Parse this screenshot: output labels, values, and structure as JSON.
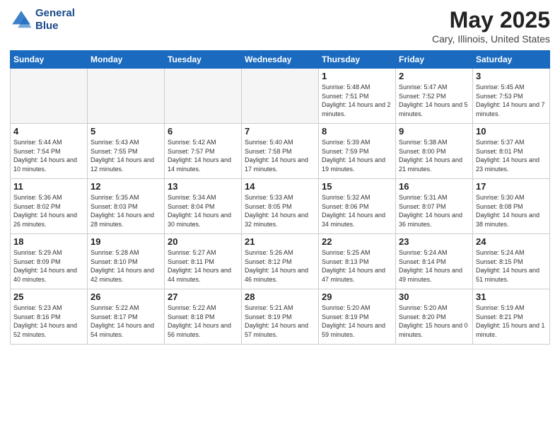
{
  "header": {
    "logo_line1": "General",
    "logo_line2": "Blue",
    "month": "May 2025",
    "location": "Cary, Illinois, United States"
  },
  "weekdays": [
    "Sunday",
    "Monday",
    "Tuesday",
    "Wednesday",
    "Thursday",
    "Friday",
    "Saturday"
  ],
  "weeks": [
    [
      {
        "day": "",
        "empty": true
      },
      {
        "day": "",
        "empty": true
      },
      {
        "day": "",
        "empty": true
      },
      {
        "day": "",
        "empty": true
      },
      {
        "day": "1",
        "sunrise": "5:48 AM",
        "sunset": "7:51 PM",
        "daylight": "14 hours and 2 minutes."
      },
      {
        "day": "2",
        "sunrise": "5:47 AM",
        "sunset": "7:52 PM",
        "daylight": "14 hours and 5 minutes."
      },
      {
        "day": "3",
        "sunrise": "5:45 AM",
        "sunset": "7:53 PM",
        "daylight": "14 hours and 7 minutes."
      }
    ],
    [
      {
        "day": "4",
        "sunrise": "5:44 AM",
        "sunset": "7:54 PM",
        "daylight": "14 hours and 10 minutes."
      },
      {
        "day": "5",
        "sunrise": "5:43 AM",
        "sunset": "7:55 PM",
        "daylight": "14 hours and 12 minutes."
      },
      {
        "day": "6",
        "sunrise": "5:42 AM",
        "sunset": "7:57 PM",
        "daylight": "14 hours and 14 minutes."
      },
      {
        "day": "7",
        "sunrise": "5:40 AM",
        "sunset": "7:58 PM",
        "daylight": "14 hours and 17 minutes."
      },
      {
        "day": "8",
        "sunrise": "5:39 AM",
        "sunset": "7:59 PM",
        "daylight": "14 hours and 19 minutes."
      },
      {
        "day": "9",
        "sunrise": "5:38 AM",
        "sunset": "8:00 PM",
        "daylight": "14 hours and 21 minutes."
      },
      {
        "day": "10",
        "sunrise": "5:37 AM",
        "sunset": "8:01 PM",
        "daylight": "14 hours and 23 minutes."
      }
    ],
    [
      {
        "day": "11",
        "sunrise": "5:36 AM",
        "sunset": "8:02 PM",
        "daylight": "14 hours and 26 minutes."
      },
      {
        "day": "12",
        "sunrise": "5:35 AM",
        "sunset": "8:03 PM",
        "daylight": "14 hours and 28 minutes."
      },
      {
        "day": "13",
        "sunrise": "5:34 AM",
        "sunset": "8:04 PM",
        "daylight": "14 hours and 30 minutes."
      },
      {
        "day": "14",
        "sunrise": "5:33 AM",
        "sunset": "8:05 PM",
        "daylight": "14 hours and 32 minutes."
      },
      {
        "day": "15",
        "sunrise": "5:32 AM",
        "sunset": "8:06 PM",
        "daylight": "14 hours and 34 minutes."
      },
      {
        "day": "16",
        "sunrise": "5:31 AM",
        "sunset": "8:07 PM",
        "daylight": "14 hours and 36 minutes."
      },
      {
        "day": "17",
        "sunrise": "5:30 AM",
        "sunset": "8:08 PM",
        "daylight": "14 hours and 38 minutes."
      }
    ],
    [
      {
        "day": "18",
        "sunrise": "5:29 AM",
        "sunset": "8:09 PM",
        "daylight": "14 hours and 40 minutes."
      },
      {
        "day": "19",
        "sunrise": "5:28 AM",
        "sunset": "8:10 PM",
        "daylight": "14 hours and 42 minutes."
      },
      {
        "day": "20",
        "sunrise": "5:27 AM",
        "sunset": "8:11 PM",
        "daylight": "14 hours and 44 minutes."
      },
      {
        "day": "21",
        "sunrise": "5:26 AM",
        "sunset": "8:12 PM",
        "daylight": "14 hours and 46 minutes."
      },
      {
        "day": "22",
        "sunrise": "5:25 AM",
        "sunset": "8:13 PM",
        "daylight": "14 hours and 47 minutes."
      },
      {
        "day": "23",
        "sunrise": "5:24 AM",
        "sunset": "8:14 PM",
        "daylight": "14 hours and 49 minutes."
      },
      {
        "day": "24",
        "sunrise": "5:24 AM",
        "sunset": "8:15 PM",
        "daylight": "14 hours and 51 minutes."
      }
    ],
    [
      {
        "day": "25",
        "sunrise": "5:23 AM",
        "sunset": "8:16 PM",
        "daylight": "14 hours and 52 minutes."
      },
      {
        "day": "26",
        "sunrise": "5:22 AM",
        "sunset": "8:17 PM",
        "daylight": "14 hours and 54 minutes."
      },
      {
        "day": "27",
        "sunrise": "5:22 AM",
        "sunset": "8:18 PM",
        "daylight": "14 hours and 56 minutes."
      },
      {
        "day": "28",
        "sunrise": "5:21 AM",
        "sunset": "8:19 PM",
        "daylight": "14 hours and 57 minutes."
      },
      {
        "day": "29",
        "sunrise": "5:20 AM",
        "sunset": "8:19 PM",
        "daylight": "14 hours and 59 minutes."
      },
      {
        "day": "30",
        "sunrise": "5:20 AM",
        "sunset": "8:20 PM",
        "daylight": "15 hours and 0 minutes."
      },
      {
        "day": "31",
        "sunrise": "5:19 AM",
        "sunset": "8:21 PM",
        "daylight": "15 hours and 1 minute."
      }
    ]
  ]
}
